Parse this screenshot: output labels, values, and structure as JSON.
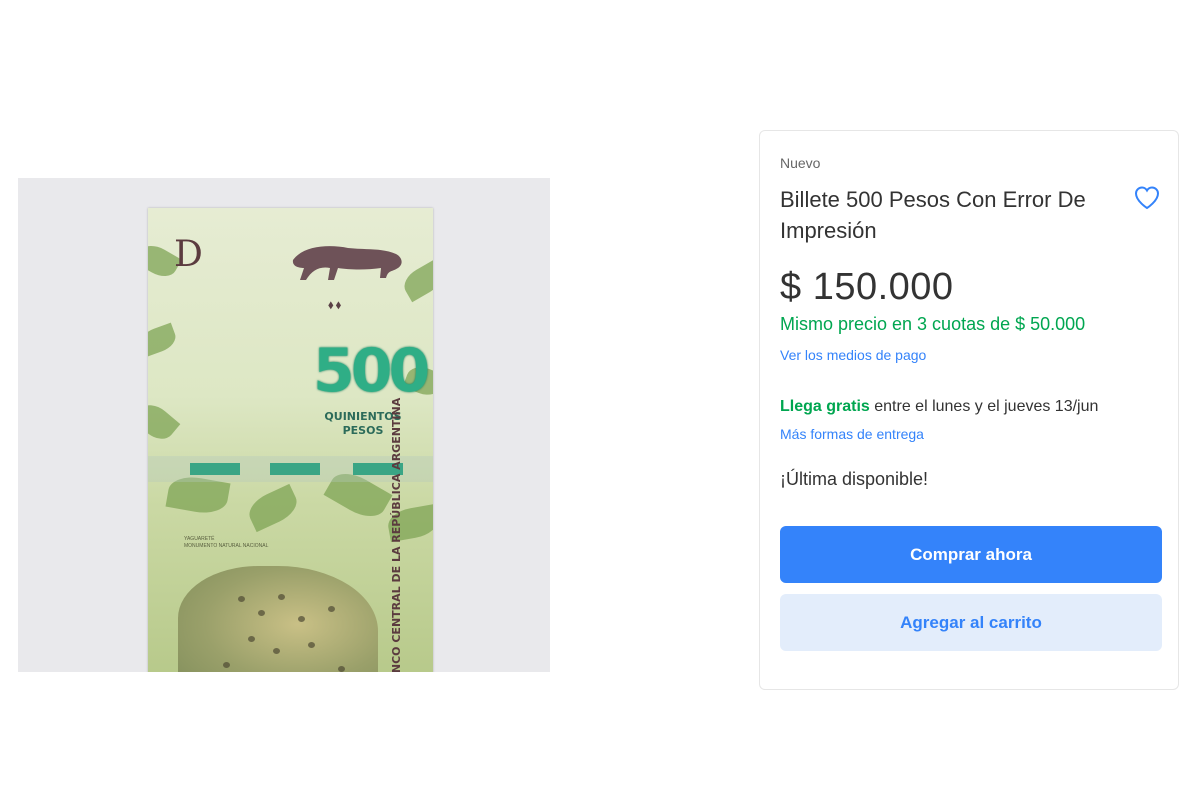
{
  "product": {
    "condition": "Nuevo",
    "title": "Billete 500 Pesos Con Error De Impresión",
    "price": "$ 150.000",
    "installments": "Mismo precio en 3 cuotas de $ 50.000",
    "payment_link": "Ver los medios de pago",
    "shipping_highlight": "Llega gratis",
    "shipping_rest": " entre el lunes y el jueves 13/jun",
    "shipping_link": "Más formas de entrega",
    "stock": "¡Última disponible!",
    "favorite_icon": "heart-outline-icon"
  },
  "actions": {
    "buy_now": "Comprar ahora",
    "add_to_cart": "Agregar al carrito"
  },
  "photo": {
    "letter": "D",
    "denomination": "500",
    "words_line1": "QUINIENTOS",
    "words_line2": "PESOS",
    "small_line1": "YAGUARETÉ",
    "small_line2": "MONUMENTO NATURAL NACIONAL",
    "bank": "BANCO CENTRAL DE LA REPÚBLICA ARGENTINA"
  },
  "colors": {
    "accent": "#3483fa",
    "success": "#00a650",
    "cart_bg": "#e3edfb"
  }
}
